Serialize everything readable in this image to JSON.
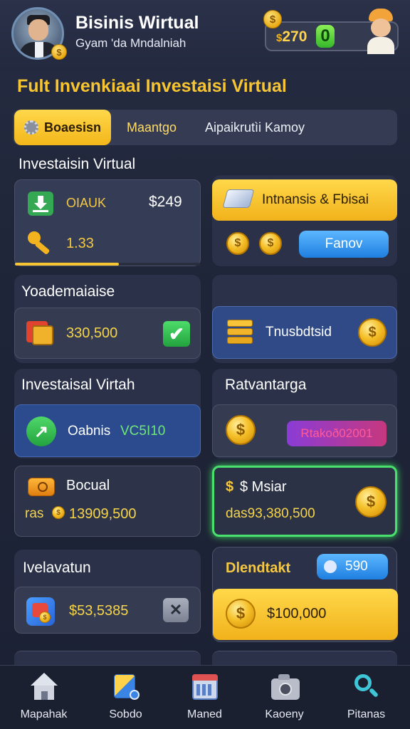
{
  "header": {
    "title": "Bisinis Wirtual",
    "subtitle": "Gyam 'da Mndalniah",
    "coin_count": "270",
    "coin_prefix": "$",
    "plus_label": "0"
  },
  "page_title": "Fult Invenkiaai Investaisi Virtual",
  "tabs": [
    {
      "label": "Boaesisn",
      "active": true
    },
    {
      "label": "Maantgo",
      "active": false
    },
    {
      "label": "Aipaikrutìi Kamoy",
      "active": false
    }
  ],
  "sections": {
    "investasi_virtual": {
      "title": "Investaisin Virtual",
      "code": "OIAUK",
      "amount": "$249",
      "value": "1.33",
      "progress": 0.56
    },
    "promo": {
      "banner_label": "Intnansis & Fbisai",
      "button_label": "Fanov"
    },
    "yoademaiaise": {
      "title": "Yoademaiaise",
      "value": "330,500"
    },
    "trusbdtsid": {
      "label": "Tnusbdtsid"
    },
    "investasi_virtah": {
      "title": "Investaisal Virtah",
      "label": "Oabnis",
      "tag": "VC5I10"
    },
    "ratvantarga": {
      "title": "Ratvantarga",
      "pill": "Rtakoð02001"
    },
    "bocual": {
      "title": "Bocual",
      "prefix": "ras",
      "value": "13909,500"
    },
    "msiar": {
      "title": "$ Msiar",
      "value": "das93,380,500"
    },
    "ivelavatun": {
      "title": "Ivelavatun",
      "value": "$53,5385"
    },
    "dlendtakt": {
      "title": "Dlendtakt",
      "badge": "590",
      "amount": "$100,000"
    }
  },
  "navbar": [
    {
      "label": "Mapahak",
      "icon": "home-icon"
    },
    {
      "label": "Sobdo",
      "icon": "cube-icon"
    },
    {
      "label": "Maned",
      "icon": "calendar-icon"
    },
    {
      "label": "Kaoeny",
      "icon": "camera-icon"
    },
    {
      "label": "Pitanas",
      "icon": "search-icon"
    }
  ],
  "colors": {
    "accent_gold": "#f7c531",
    "accent_green": "#4fe07a",
    "accent_blue": "#2f8ff0",
    "background": "#20263a"
  }
}
